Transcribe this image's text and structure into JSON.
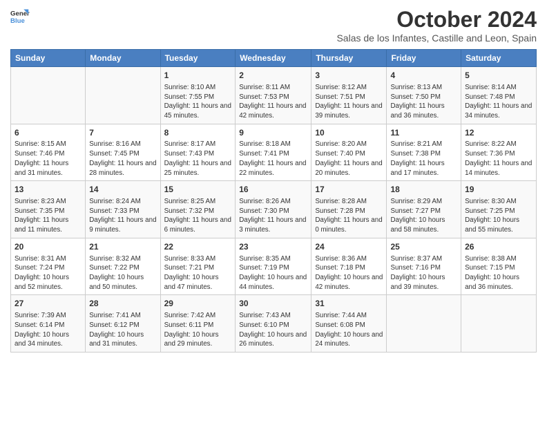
{
  "header": {
    "logo_line1": "General",
    "logo_line2": "Blue",
    "month_title": "October 2024",
    "subtitle": "Salas de los Infantes, Castille and Leon, Spain"
  },
  "days_of_week": [
    "Sunday",
    "Monday",
    "Tuesday",
    "Wednesday",
    "Thursday",
    "Friday",
    "Saturday"
  ],
  "weeks": [
    [
      {
        "day": "",
        "info": ""
      },
      {
        "day": "",
        "info": ""
      },
      {
        "day": "1",
        "info": "Sunrise: 8:10 AM\nSunset: 7:55 PM\nDaylight: 11 hours and 45 minutes."
      },
      {
        "day": "2",
        "info": "Sunrise: 8:11 AM\nSunset: 7:53 PM\nDaylight: 11 hours and 42 minutes."
      },
      {
        "day": "3",
        "info": "Sunrise: 8:12 AM\nSunset: 7:51 PM\nDaylight: 11 hours and 39 minutes."
      },
      {
        "day": "4",
        "info": "Sunrise: 8:13 AM\nSunset: 7:50 PM\nDaylight: 11 hours and 36 minutes."
      },
      {
        "day": "5",
        "info": "Sunrise: 8:14 AM\nSunset: 7:48 PM\nDaylight: 11 hours and 34 minutes."
      }
    ],
    [
      {
        "day": "6",
        "info": "Sunrise: 8:15 AM\nSunset: 7:46 PM\nDaylight: 11 hours and 31 minutes."
      },
      {
        "day": "7",
        "info": "Sunrise: 8:16 AM\nSunset: 7:45 PM\nDaylight: 11 hours and 28 minutes."
      },
      {
        "day": "8",
        "info": "Sunrise: 8:17 AM\nSunset: 7:43 PM\nDaylight: 11 hours and 25 minutes."
      },
      {
        "day": "9",
        "info": "Sunrise: 8:18 AM\nSunset: 7:41 PM\nDaylight: 11 hours and 22 minutes."
      },
      {
        "day": "10",
        "info": "Sunrise: 8:20 AM\nSunset: 7:40 PM\nDaylight: 11 hours and 20 minutes."
      },
      {
        "day": "11",
        "info": "Sunrise: 8:21 AM\nSunset: 7:38 PM\nDaylight: 11 hours and 17 minutes."
      },
      {
        "day": "12",
        "info": "Sunrise: 8:22 AM\nSunset: 7:36 PM\nDaylight: 11 hours and 14 minutes."
      }
    ],
    [
      {
        "day": "13",
        "info": "Sunrise: 8:23 AM\nSunset: 7:35 PM\nDaylight: 11 hours and 11 minutes."
      },
      {
        "day": "14",
        "info": "Sunrise: 8:24 AM\nSunset: 7:33 PM\nDaylight: 11 hours and 9 minutes."
      },
      {
        "day": "15",
        "info": "Sunrise: 8:25 AM\nSunset: 7:32 PM\nDaylight: 11 hours and 6 minutes."
      },
      {
        "day": "16",
        "info": "Sunrise: 8:26 AM\nSunset: 7:30 PM\nDaylight: 11 hours and 3 minutes."
      },
      {
        "day": "17",
        "info": "Sunrise: 8:28 AM\nSunset: 7:28 PM\nDaylight: 11 hours and 0 minutes."
      },
      {
        "day": "18",
        "info": "Sunrise: 8:29 AM\nSunset: 7:27 PM\nDaylight: 10 hours and 58 minutes."
      },
      {
        "day": "19",
        "info": "Sunrise: 8:30 AM\nSunset: 7:25 PM\nDaylight: 10 hours and 55 minutes."
      }
    ],
    [
      {
        "day": "20",
        "info": "Sunrise: 8:31 AM\nSunset: 7:24 PM\nDaylight: 10 hours and 52 minutes."
      },
      {
        "day": "21",
        "info": "Sunrise: 8:32 AM\nSunset: 7:22 PM\nDaylight: 10 hours and 50 minutes."
      },
      {
        "day": "22",
        "info": "Sunrise: 8:33 AM\nSunset: 7:21 PM\nDaylight: 10 hours and 47 minutes."
      },
      {
        "day": "23",
        "info": "Sunrise: 8:35 AM\nSunset: 7:19 PM\nDaylight: 10 hours and 44 minutes."
      },
      {
        "day": "24",
        "info": "Sunrise: 8:36 AM\nSunset: 7:18 PM\nDaylight: 10 hours and 42 minutes."
      },
      {
        "day": "25",
        "info": "Sunrise: 8:37 AM\nSunset: 7:16 PM\nDaylight: 10 hours and 39 minutes."
      },
      {
        "day": "26",
        "info": "Sunrise: 8:38 AM\nSunset: 7:15 PM\nDaylight: 10 hours and 36 minutes."
      }
    ],
    [
      {
        "day": "27",
        "info": "Sunrise: 7:39 AM\nSunset: 6:14 PM\nDaylight: 10 hours and 34 minutes."
      },
      {
        "day": "28",
        "info": "Sunrise: 7:41 AM\nSunset: 6:12 PM\nDaylight: 10 hours and 31 minutes."
      },
      {
        "day": "29",
        "info": "Sunrise: 7:42 AM\nSunset: 6:11 PM\nDaylight: 10 hours and 29 minutes."
      },
      {
        "day": "30",
        "info": "Sunrise: 7:43 AM\nSunset: 6:10 PM\nDaylight: 10 hours and 26 minutes."
      },
      {
        "day": "31",
        "info": "Sunrise: 7:44 AM\nSunset: 6:08 PM\nDaylight: 10 hours and 24 minutes."
      },
      {
        "day": "",
        "info": ""
      },
      {
        "day": "",
        "info": ""
      }
    ]
  ]
}
